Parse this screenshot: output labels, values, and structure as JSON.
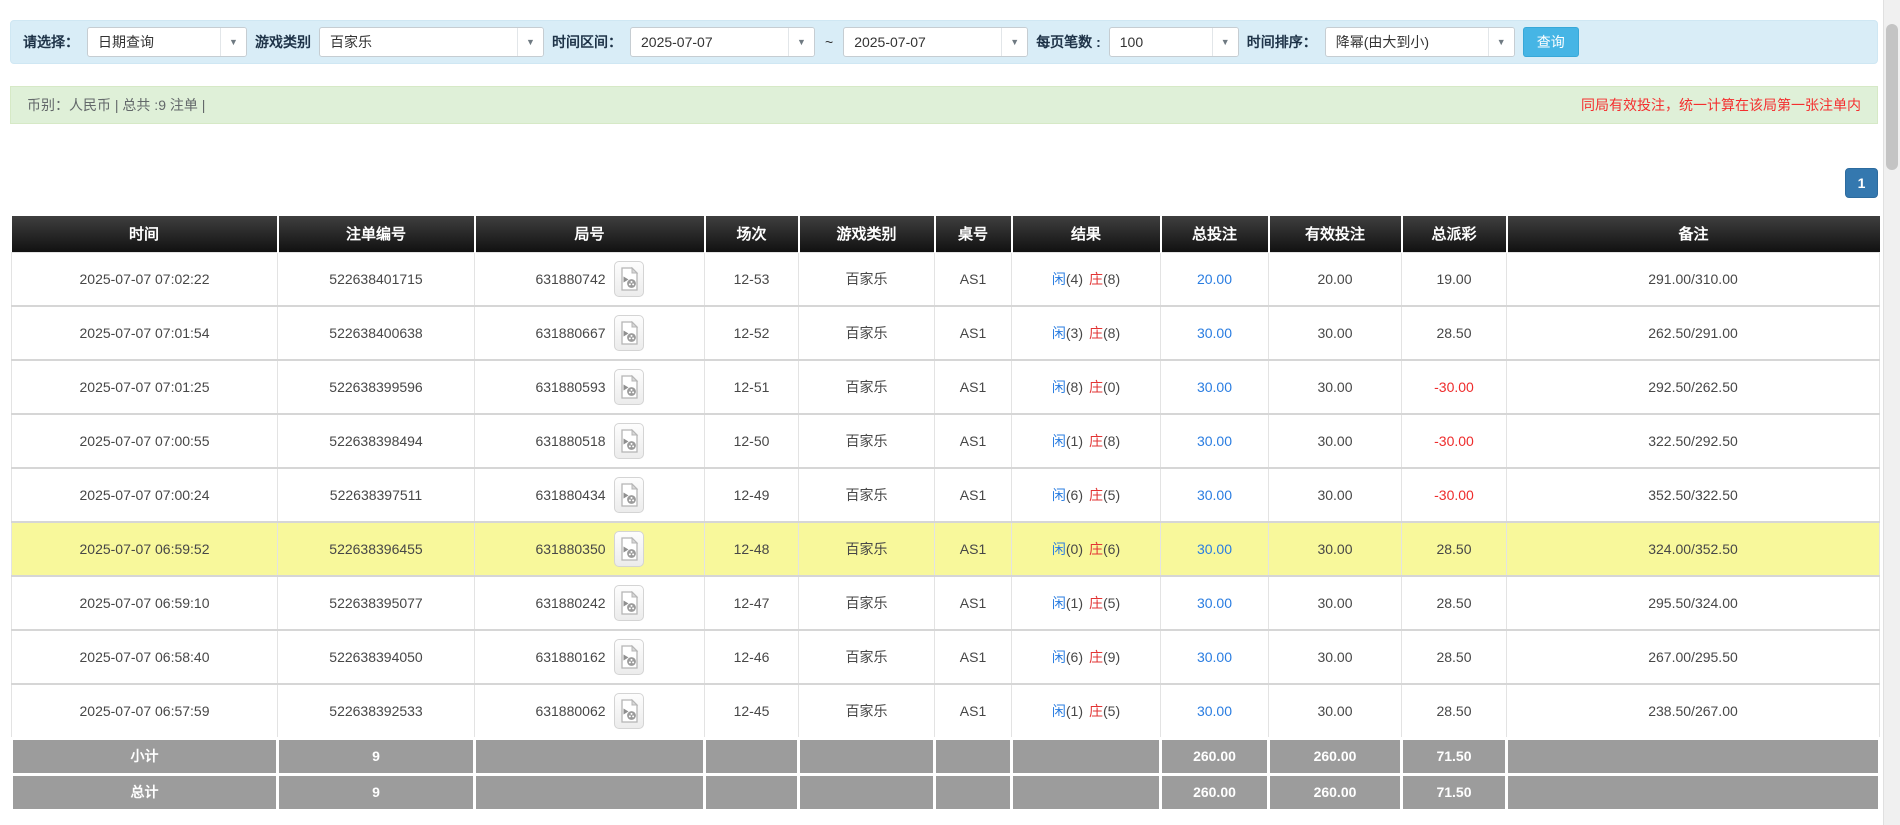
{
  "icons": {
    "dropdown_arrow": "▼"
  },
  "filters": {
    "query_type": {
      "label": "请选择：",
      "value": "日期查询"
    },
    "game_category": {
      "label": "游戏类别",
      "value": "百家乐"
    },
    "time_range": {
      "label": "时间区间：",
      "from": "2025-07-07",
      "separator": "~",
      "to": "2025-07-07"
    },
    "page_size": {
      "label": "每页笔数 :",
      "value": "100"
    },
    "time_sort": {
      "label": "时间排序：",
      "value": "降幂(由大到小)"
    },
    "search_button": "查询"
  },
  "summary_bar": {
    "left_text": "币别：人民币 | 总共 :9 注单 |",
    "right_text": "同局有效投注，统一计算在该局第一张注单内"
  },
  "pagination": {
    "current_page": "1"
  },
  "colors": {
    "accent_blue": "#2a7de1",
    "banker_red": "#e23434",
    "negative_red": "#ee2c2c",
    "highlight_yellow": "#f8f89b",
    "filter_bg": "#d9edf7",
    "info_bg": "#dff0d8"
  },
  "table": {
    "columns": [
      "时间",
      "注单编号",
      "局号",
      "场次",
      "游戏类别",
      "桌号",
      "结果",
      "总投注",
      "有效投注",
      "总派彩",
      "备注"
    ],
    "rows": [
      {
        "time": "2025-07-07 07:02:22",
        "bet_id": "522638401715",
        "round_id": "631880742",
        "session": "12-53",
        "game": "百家乐",
        "table_no": "AS1",
        "player": "闲",
        "player_score": "(4)",
        "banker": "庄",
        "banker_score": "(8)",
        "total_bet": "20.00",
        "valid_bet": "20.00",
        "payout": "19.00",
        "note": "291.00/310.00",
        "highlight": false
      },
      {
        "time": "2025-07-07 07:01:54",
        "bet_id": "522638400638",
        "round_id": "631880667",
        "session": "12-52",
        "game": "百家乐",
        "table_no": "AS1",
        "player": "闲",
        "player_score": "(3)",
        "banker": "庄",
        "banker_score": "(8)",
        "total_bet": "30.00",
        "valid_bet": "30.00",
        "payout": "28.50",
        "note": "262.50/291.00",
        "highlight": false
      },
      {
        "time": "2025-07-07 07:01:25",
        "bet_id": "522638399596",
        "round_id": "631880593",
        "session": "12-51",
        "game": "百家乐",
        "table_no": "AS1",
        "player": "闲",
        "player_score": "(8)",
        "banker": "庄",
        "banker_score": "(0)",
        "total_bet": "30.00",
        "valid_bet": "30.00",
        "payout": "-30.00",
        "note": "292.50/262.50",
        "highlight": false
      },
      {
        "time": "2025-07-07 07:00:55",
        "bet_id": "522638398494",
        "round_id": "631880518",
        "session": "12-50",
        "game": "百家乐",
        "table_no": "AS1",
        "player": "闲",
        "player_score": "(1)",
        "banker": "庄",
        "banker_score": "(8)",
        "total_bet": "30.00",
        "valid_bet": "30.00",
        "payout": "-30.00",
        "note": "322.50/292.50",
        "highlight": false
      },
      {
        "time": "2025-07-07 07:00:24",
        "bet_id": "522638397511",
        "round_id": "631880434",
        "session": "12-49",
        "game": "百家乐",
        "table_no": "AS1",
        "player": "闲",
        "player_score": "(6)",
        "banker": "庄",
        "banker_score": "(5)",
        "total_bet": "30.00",
        "valid_bet": "30.00",
        "payout": "-30.00",
        "note": "352.50/322.50",
        "highlight": false
      },
      {
        "time": "2025-07-07 06:59:52",
        "bet_id": "522638396455",
        "round_id": "631880350",
        "session": "12-48",
        "game": "百家乐",
        "table_no": "AS1",
        "player": "闲",
        "player_score": "(0)",
        "banker": "庄",
        "banker_score": "(6)",
        "total_bet": "30.00",
        "valid_bet": "30.00",
        "payout": "28.50",
        "note": "324.00/352.50",
        "highlight": true
      },
      {
        "time": "2025-07-07 06:59:10",
        "bet_id": "522638395077",
        "round_id": "631880242",
        "session": "12-47",
        "game": "百家乐",
        "table_no": "AS1",
        "player": "闲",
        "player_score": "(1)",
        "banker": "庄",
        "banker_score": "(5)",
        "total_bet": "30.00",
        "valid_bet": "30.00",
        "payout": "28.50",
        "note": "295.50/324.00",
        "highlight": false
      },
      {
        "time": "2025-07-07 06:58:40",
        "bet_id": "522638394050",
        "round_id": "631880162",
        "session": "12-46",
        "game": "百家乐",
        "table_no": "AS1",
        "player": "闲",
        "player_score": "(6)",
        "banker": "庄",
        "banker_score": "(9)",
        "total_bet": "30.00",
        "valid_bet": "30.00",
        "payout": "28.50",
        "note": "267.00/295.50",
        "highlight": false
      },
      {
        "time": "2025-07-07 06:57:59",
        "bet_id": "522638392533",
        "round_id": "631880062",
        "session": "12-45",
        "game": "百家乐",
        "table_no": "AS1",
        "player": "闲",
        "player_score": "(1)",
        "banker": "庄",
        "banker_score": "(5)",
        "total_bet": "30.00",
        "valid_bet": "30.00",
        "payout": "28.50",
        "note": "238.50/267.00",
        "highlight": false
      }
    ],
    "subtotal": {
      "label": "小计",
      "count": "9",
      "total_bet": "260.00",
      "valid_bet": "260.00",
      "payout": "71.50"
    },
    "grand_total": {
      "label": "总计",
      "count": "9",
      "total_bet": "260.00",
      "valid_bet": "260.00",
      "payout": "71.50"
    }
  }
}
